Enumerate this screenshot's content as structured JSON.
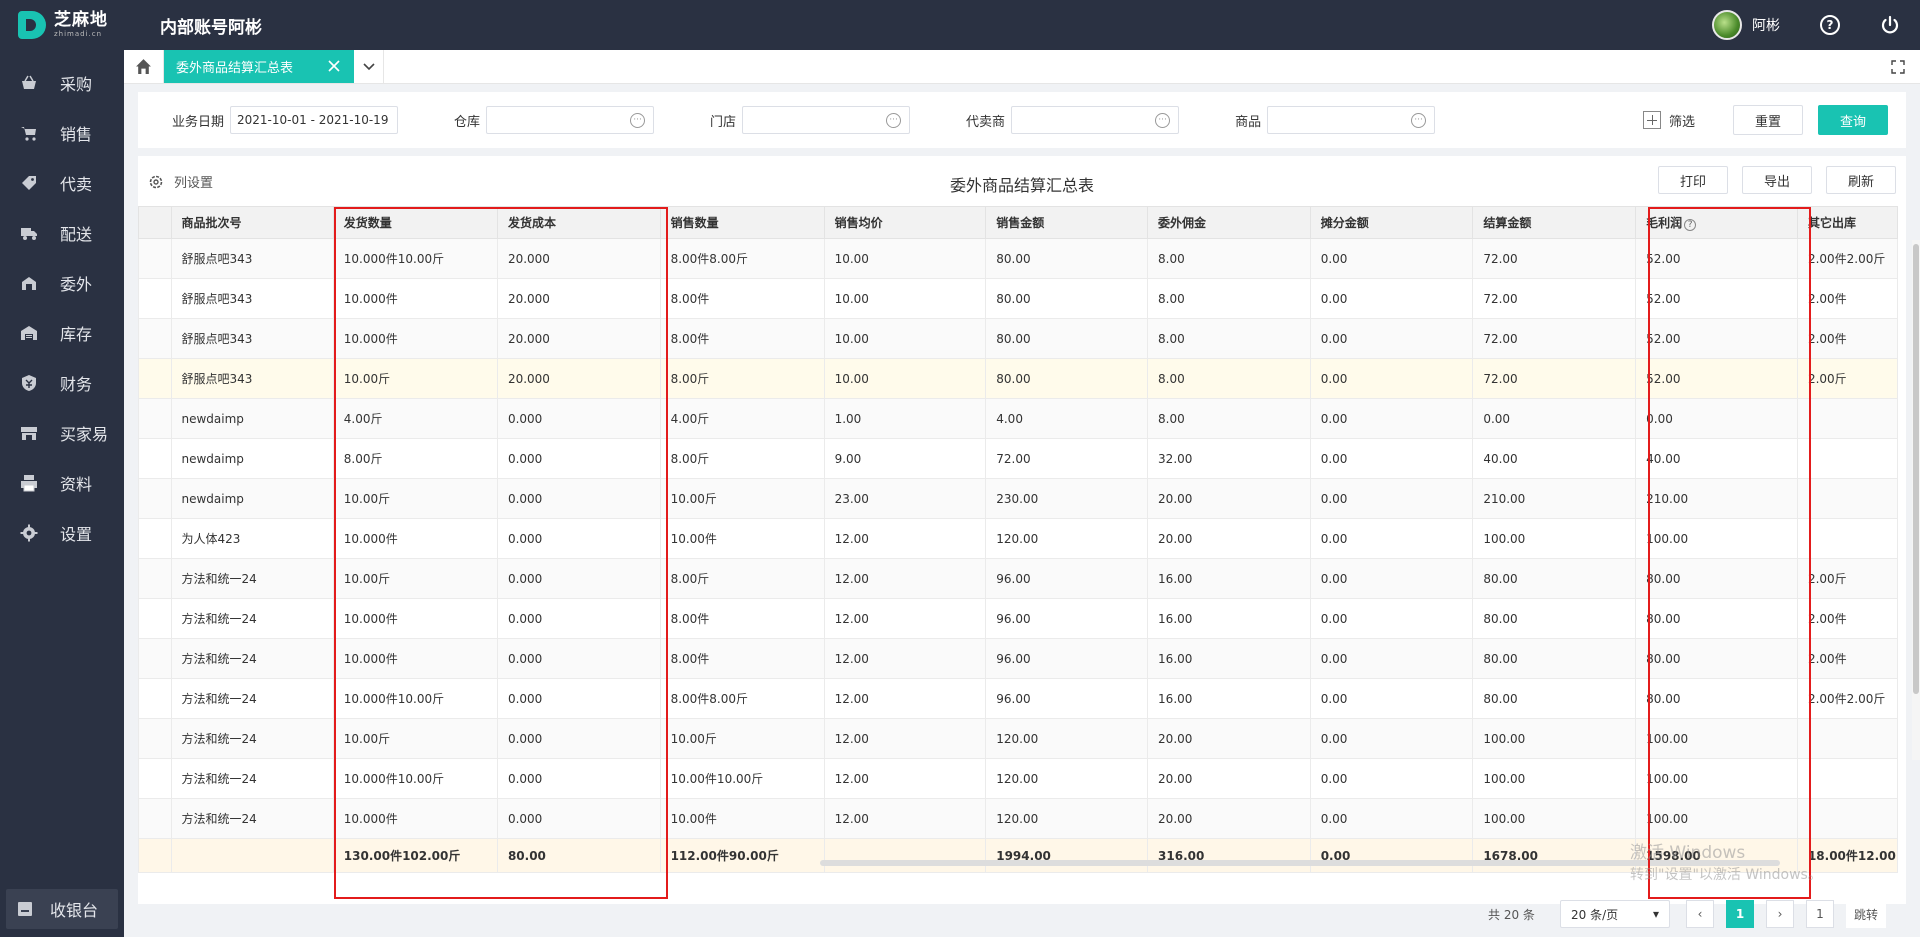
{
  "brand": {
    "name_cn": "芝麻地",
    "name_en": "zhimadi.cn",
    "color": "#19c3b2"
  },
  "header": {
    "account_title": "内部账号阿彬",
    "username": "阿彬",
    "help_glyph": "?"
  },
  "sidebar": {
    "items": [
      {
        "label": "采购",
        "icon": "basket-icon"
      },
      {
        "label": "销售",
        "icon": "cart-icon"
      },
      {
        "label": "代卖",
        "icon": "tag-icon"
      },
      {
        "label": "配送",
        "icon": "truck-icon"
      },
      {
        "label": "委外",
        "icon": "outsource-icon"
      },
      {
        "label": "库存",
        "icon": "warehouse-icon"
      },
      {
        "label": "财务",
        "icon": "finance-icon"
      },
      {
        "label": "买家易",
        "icon": "store-icon"
      },
      {
        "label": "资料",
        "icon": "printer-icon"
      },
      {
        "label": "设置",
        "icon": "gear-icon"
      }
    ],
    "cashier_label": "收银台"
  },
  "tabs": {
    "active_label": "委外商品结算汇总表"
  },
  "filters": {
    "date_label": "业务日期",
    "date_value": "2021-10-01 - 2021-10-19",
    "warehouse_label": "仓库",
    "store_label": "门店",
    "agent_label": "代卖商",
    "product_label": "商品",
    "more_glyph": "···",
    "filter_toggle_label": "筛选",
    "reset_label": "重置",
    "query_label": "查询"
  },
  "report": {
    "column_settings_label": "列设置",
    "title": "委外商品结算汇总表",
    "print_label": "打印",
    "export_label": "导出",
    "refresh_label": "刷新"
  },
  "table": {
    "columns": [
      "",
      "商品批次号",
      "发货数量",
      "发货成本",
      "销售数量",
      "销售均价",
      "销售金额",
      "委外佣金",
      "摊分金额",
      "结算金额",
      "毛利润",
      "其它出库"
    ],
    "gross_profit_help_glyph": "?",
    "rows": [
      [
        "",
        "舒服点吧343",
        "10.000件10.00斤",
        "20.000",
        "8.00件8.00斤",
        "10.00",
        "80.00",
        "8.00",
        "0.00",
        "72.00",
        "52.00",
        "2.00件2.00斤"
      ],
      [
        "",
        "舒服点吧343",
        "10.000件",
        "20.000",
        "8.00件",
        "10.00",
        "80.00",
        "8.00",
        "0.00",
        "72.00",
        "52.00",
        "2.00件"
      ],
      [
        "",
        "舒服点吧343",
        "10.000件",
        "20.000",
        "8.00件",
        "10.00",
        "80.00",
        "8.00",
        "0.00",
        "72.00",
        "52.00",
        "2.00件"
      ],
      [
        "",
        "舒服点吧343",
        "10.00斤",
        "20.000",
        "8.00斤",
        "10.00",
        "80.00",
        "8.00",
        "0.00",
        "72.00",
        "52.00",
        "2.00斤"
      ],
      [
        "",
        "newdaimp",
        "4.00斤",
        "0.000",
        "4.00斤",
        "1.00",
        "4.00",
        "8.00",
        "0.00",
        "0.00",
        "0.00",
        ""
      ],
      [
        "",
        "newdaimp",
        "8.00斤",
        "0.000",
        "8.00斤",
        "9.00",
        "72.00",
        "32.00",
        "0.00",
        "40.00",
        "40.00",
        ""
      ],
      [
        "",
        "newdaimp",
        "10.00斤",
        "0.000",
        "10.00斤",
        "23.00",
        "230.00",
        "20.00",
        "0.00",
        "210.00",
        "210.00",
        ""
      ],
      [
        "",
        "为人体423",
        "10.000件",
        "0.000",
        "10.00件",
        "12.00",
        "120.00",
        "20.00",
        "0.00",
        "100.00",
        "100.00",
        ""
      ],
      [
        "",
        "方法和统一24",
        "10.00斤",
        "0.000",
        "8.00斤",
        "12.00",
        "96.00",
        "16.00",
        "0.00",
        "80.00",
        "80.00",
        "2.00斤"
      ],
      [
        "",
        "方法和统一24",
        "10.000件",
        "0.000",
        "8.00件",
        "12.00",
        "96.00",
        "16.00",
        "0.00",
        "80.00",
        "80.00",
        "2.00件"
      ],
      [
        "",
        "方法和统一24",
        "10.000件",
        "0.000",
        "8.00件",
        "12.00",
        "96.00",
        "16.00",
        "0.00",
        "80.00",
        "80.00",
        "2.00件"
      ],
      [
        "",
        "方法和统一24",
        "10.000件10.00斤",
        "0.000",
        "8.00件8.00斤",
        "12.00",
        "96.00",
        "16.00",
        "0.00",
        "80.00",
        "80.00",
        "2.00件2.00斤"
      ],
      [
        "",
        "方法和统一24",
        "10.00斤",
        "0.000",
        "10.00斤",
        "12.00",
        "120.00",
        "20.00",
        "0.00",
        "100.00",
        "100.00",
        ""
      ],
      [
        "",
        "方法和统一24",
        "10.000件10.00斤",
        "0.000",
        "10.00件10.00斤",
        "12.00",
        "120.00",
        "20.00",
        "0.00",
        "100.00",
        "100.00",
        ""
      ],
      [
        "",
        "方法和统一24",
        "10.000件",
        "0.000",
        "10.00件",
        "12.00",
        "120.00",
        "20.00",
        "0.00",
        "100.00",
        "100.00",
        ""
      ]
    ],
    "totals": [
      "",
      "",
      "130.00件102.00斤",
      "80.00",
      "112.00件90.00斤",
      "",
      "1994.00",
      "316.00",
      "0.00",
      "1678.00",
      "1598.00",
      "18.00件12.00"
    ]
  },
  "watermark": {
    "line1": "激活 Windows",
    "line2": "转到\"设置\"以激活 Windows。"
  },
  "pagination": {
    "total_text": "共 20 条",
    "page_size": "20 条/页",
    "current_page": "1",
    "jump_value": "1",
    "jump_label": "跳转",
    "prev_glyph": "‹",
    "next_glyph": "›",
    "dropdown_glyph": "▾"
  }
}
